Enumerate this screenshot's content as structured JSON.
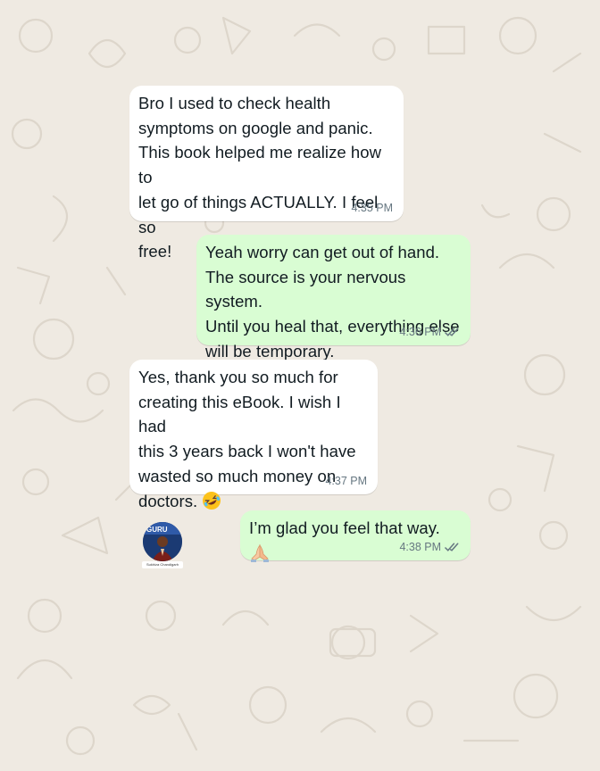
{
  "chat": {
    "messages": [
      {
        "direction": "in",
        "text": "Bro I used to check health\nsymptoms on google and panic.\nThis book helped me realize how to\nlet go of things ACTUALLY. I feel so\nfree!",
        "time": "4:35 PM"
      },
      {
        "direction": "out",
        "text": "Yeah worry can get out of hand.\nThe source is your nervous system.\nUntil you heal that, everything else\nwill be temporary.",
        "time": "4:36 PM",
        "status": "read"
      },
      {
        "direction": "in",
        "text": "Yes, thank you so much for\ncreating this eBook. I wish I had\nthis 3 years back I won't have\nwasted so much money on\ndoctors.",
        "emoji": "rolling-on-floor-laughing",
        "time": "4:37 PM"
      },
      {
        "direction": "out",
        "text": "I’m glad you feel that way.",
        "emoji": "folded-hands",
        "time": "4:38 PM",
        "status": "read"
      }
    ]
  },
  "avatar": {
    "badge_text": "GURU",
    "caption": "Sukhiza Chandigarh"
  },
  "colors": {
    "wallpaper": "#efeae2",
    "incoming": "#ffffff",
    "outgoing": "#d9fdd3",
    "meta": "#667781",
    "text": "#111b21"
  }
}
